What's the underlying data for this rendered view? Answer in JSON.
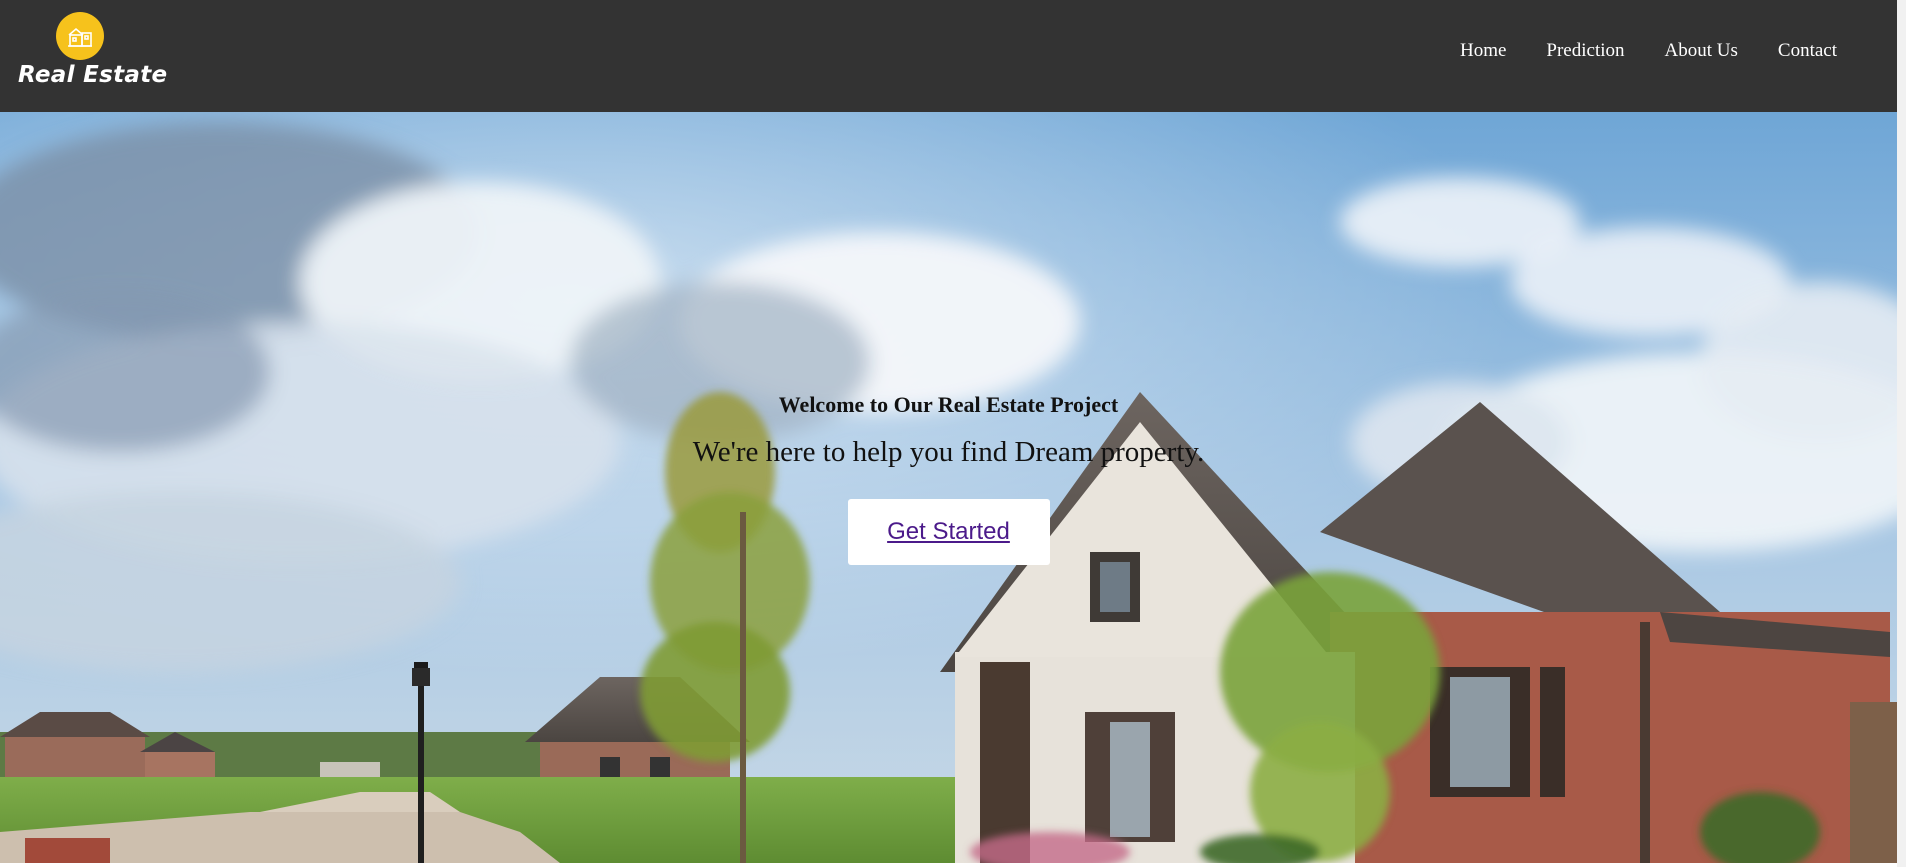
{
  "brand": {
    "name": "Real Estate",
    "logo_icon": "house-building-icon",
    "badge_color": "#f6c21c"
  },
  "nav": {
    "items": [
      {
        "label": "Home"
      },
      {
        "label": "Prediction"
      },
      {
        "label": "About Us"
      },
      {
        "label": "Contact"
      }
    ]
  },
  "hero": {
    "title": "Welcome to Our Real Estate Project",
    "subtitle": "We're here to help you find Dream property.",
    "cta_label": "Get Started",
    "background": "suburban-house-photo"
  },
  "colors": {
    "navbar_bg": "#333333",
    "cta_text": "#4b1a8a"
  }
}
